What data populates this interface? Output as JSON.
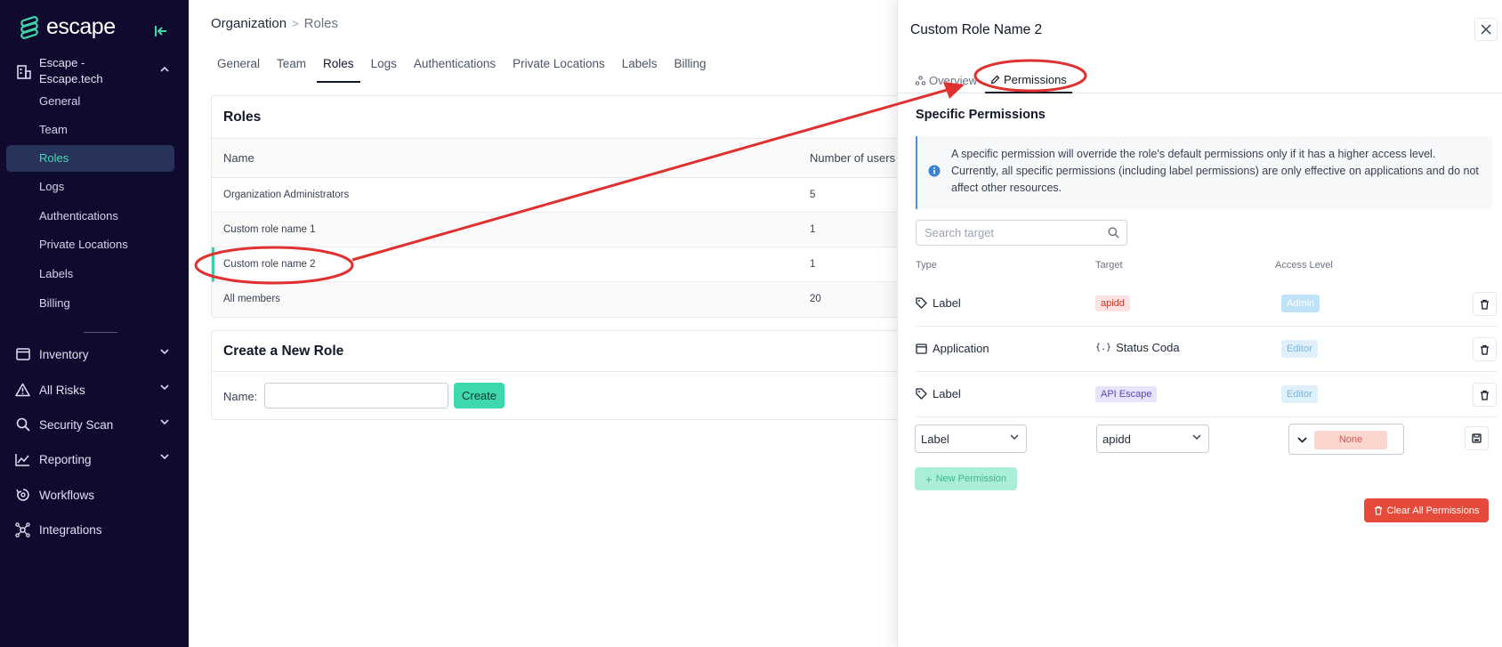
{
  "brand": {
    "name": "escape",
    "accent": "#3ed8ad",
    "sidebar_bg": "#0f0a2e"
  },
  "sidebar": {
    "org_name": "Escape - Escape.tech",
    "org_items": [
      {
        "label": "General"
      },
      {
        "label": "Team"
      },
      {
        "label": "Roles",
        "active": true
      },
      {
        "label": "Logs"
      },
      {
        "label": "Authentications"
      },
      {
        "label": "Private Locations"
      },
      {
        "label": "Labels"
      },
      {
        "label": "Billing"
      }
    ],
    "main_items": [
      {
        "label": "Inventory",
        "icon": "inventory-icon"
      },
      {
        "label": "All Risks",
        "icon": "warning-icon"
      },
      {
        "label": "Security Scan",
        "icon": "search-icon"
      },
      {
        "label": "Reporting",
        "icon": "chart-icon"
      },
      {
        "label": "Workflows",
        "icon": "workflow-icon"
      },
      {
        "label": "Integrations",
        "icon": "integrations-icon"
      }
    ]
  },
  "breadcrumb": {
    "org": "Organization",
    "current": "Roles"
  },
  "tabs": [
    "General",
    "Team",
    "Roles",
    "Logs",
    "Authentications",
    "Private Locations",
    "Labels",
    "Billing"
  ],
  "roles_card": {
    "title": "Roles",
    "columns": {
      "name": "Name",
      "users": "Number of users"
    },
    "rows": [
      {
        "name": "Organization Administrators",
        "users": "5"
      },
      {
        "name": "Custom role name 1",
        "users": "1"
      },
      {
        "name": "Custom role name 2",
        "users": "1"
      },
      {
        "name": "All members",
        "users": "20"
      }
    ]
  },
  "create_card": {
    "title": "Create a New Role",
    "name_label": "Name:",
    "input_value": "",
    "button": "Create"
  },
  "drawer": {
    "title": "Custom Role Name 2",
    "tabs": {
      "overview": "Overview",
      "permissions": "Permissions"
    },
    "section_title": "Specific Permissions",
    "info_text": "A specific permission will override the role's default permissions only if it has a higher access level. Currently, all specific permissions (including label permissions) are only effective on applications and do not affect other resources.",
    "search_placeholder": "Search target",
    "columns": {
      "type": "Type",
      "target": "Target",
      "access": "Access Level"
    },
    "rows": [
      {
        "type": "Label",
        "target": "apidd",
        "access": "Admin"
      },
      {
        "type": "Application",
        "target": "Status Coda",
        "access": "Editor"
      },
      {
        "type": "Label",
        "target": "API Escape",
        "access": "Editor"
      }
    ],
    "new_row": {
      "type": "Label",
      "target": "apidd",
      "access": "None"
    },
    "new_permission_button": "New Permission",
    "clear_button": "Clear All Permissions"
  }
}
